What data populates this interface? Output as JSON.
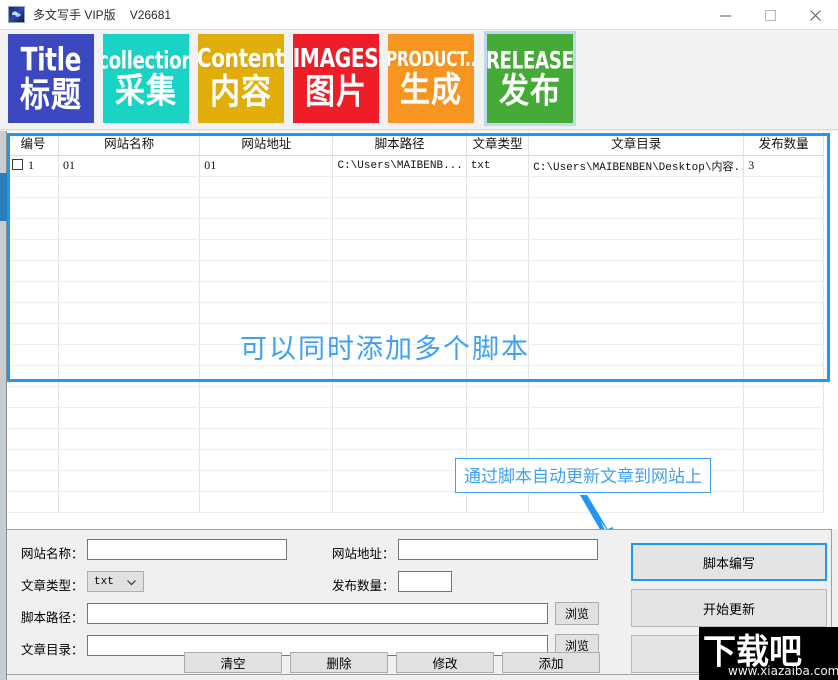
{
  "window": {
    "title": "多文写手 VIP版",
    "version": "V26681",
    "icon": "app-icon",
    "controls": {
      "minimize": "minimize-icon",
      "maximize": "maximize-icon",
      "close": "close-icon"
    }
  },
  "toolbar": {
    "tiles": [
      {
        "en": "Title",
        "cn": "标题",
        "color": "#3b48c0",
        "selected": false
      },
      {
        "en": "collection",
        "cn": "采集",
        "color": "#19d3c5",
        "selected": false
      },
      {
        "en": "Content",
        "cn": "内容",
        "color": "#e0ad09",
        "selected": false
      },
      {
        "en": "IMAGES",
        "cn": "图片",
        "color": "#ef1d27",
        "selected": false
      },
      {
        "en": "PRODUCT..",
        "cn": "生成",
        "color": "#f79520",
        "selected": false
      },
      {
        "en": "RELEASE",
        "cn": "发布",
        "color": "#45aa36",
        "selected": true
      }
    ]
  },
  "grid": {
    "headers": [
      "编号",
      "网站名称",
      "网站地址",
      "脚本路径",
      "文章类型",
      "文章目录",
      "发布数量"
    ],
    "rows": [
      {
        "checked": false,
        "编号": "1",
        "网站名称": "01",
        "网站地址": "01",
        "脚本路径": "C:\\Users\\MAIBENB...",
        "文章类型": "txt",
        "文章目录": "C:\\Users\\MAIBENBEN\\Desktop\\内容...",
        "发布数量": "3"
      }
    ]
  },
  "annotations": {
    "grid_note": "可以同时添加多个脚本",
    "callout": "通过脚本自动更新文章到网站上",
    "accent_color": "#2196f3"
  },
  "form": {
    "site_name_label": "网站名称：",
    "site_name_value": "",
    "site_url_label": "网站地址：",
    "site_url_value": "",
    "article_type_label": "文章类型：",
    "article_type_value": "txt",
    "publish_count_label": "发布数量：",
    "publish_count_value": "",
    "script_path_label": "脚本路径：",
    "script_path_value": "",
    "article_dir_label": "文章目录：",
    "article_dir_value": "",
    "browse_label_1": "浏览",
    "browse_label_2": "浏览",
    "buttons": [
      "清空",
      "删除",
      "修改",
      "添加"
    ]
  },
  "side_buttons": [
    {
      "label": "脚本编写",
      "focused": true
    },
    {
      "label": "开始更新",
      "focused": false
    },
    {
      "label": "",
      "focused": false
    }
  ],
  "watermark": {
    "cn": "下载吧",
    "url": "www.xiazaiba.com"
  }
}
